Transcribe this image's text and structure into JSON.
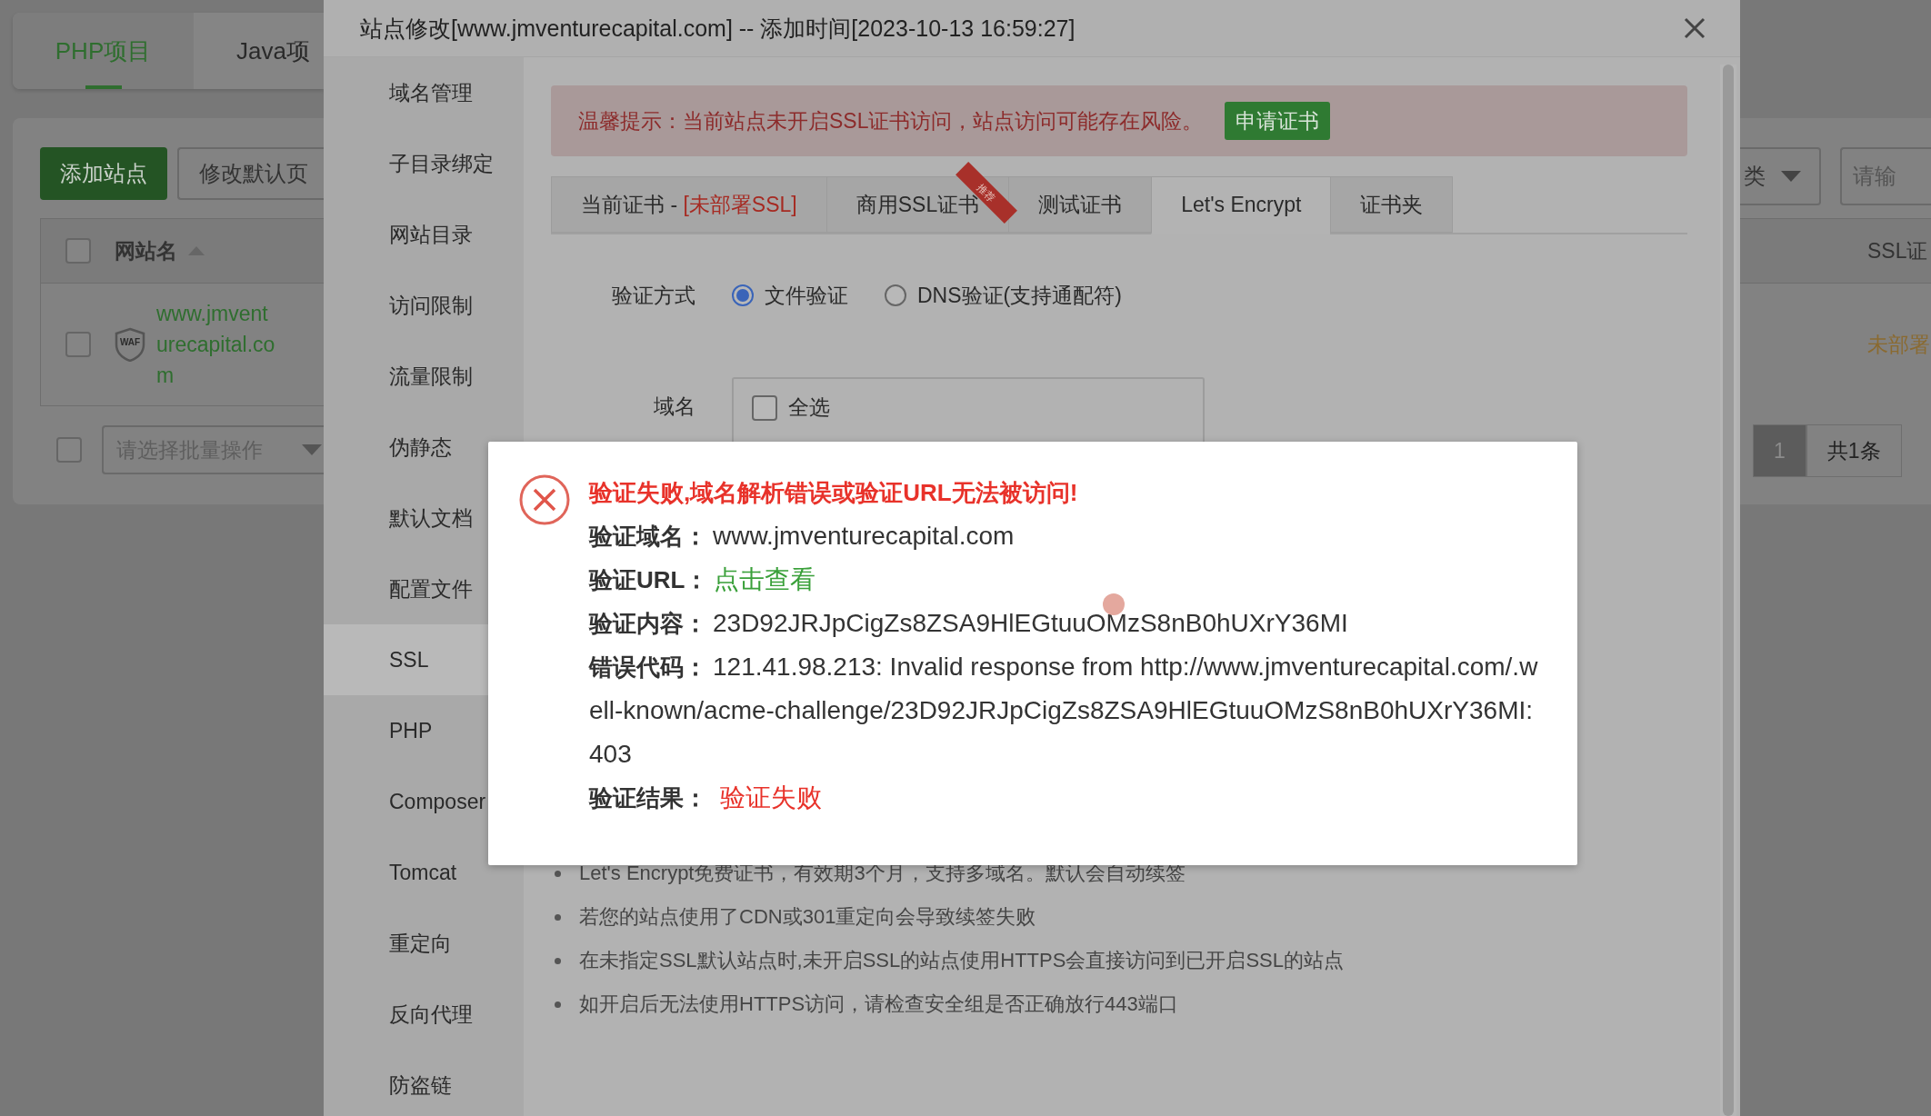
{
  "background_page": {
    "project_tabs": [
      {
        "label": "PHP项目",
        "selected": true
      },
      {
        "label": "Java项",
        "selected": false
      }
    ],
    "toolbar_buttons": [
      {
        "label": "添加站点",
        "kind": "primary"
      },
      {
        "label": "修改默认页",
        "kind": "default"
      }
    ],
    "category_select": {
      "value": "类"
    },
    "search_field": {
      "placeholder": "请输"
    },
    "table": {
      "header_checked": false,
      "columns": [
        "网站名",
        "SSL证"
      ],
      "rows": [
        {
          "checked": false,
          "badge": "WAF",
          "name": "www.jmventurecapital.com",
          "ssl": "未部署"
        }
      ]
    },
    "batch": {
      "checked": false,
      "placeholder": "请选择批量操作"
    },
    "pagination": {
      "pages": [
        {
          "label": "1",
          "selected": true
        }
      ],
      "total": "共1条"
    }
  },
  "modal": {
    "title": "站点修改[www.jmventurecapital.com] -- 添加时间[2023-10-13 16:59:27]",
    "sidebar": {
      "items": [
        {
          "label": "域名管理",
          "selected": false
        },
        {
          "label": "子目录绑定",
          "selected": false
        },
        {
          "label": "网站目录",
          "selected": false
        },
        {
          "label": "访问限制",
          "selected": false
        },
        {
          "label": "流量限制",
          "selected": false
        },
        {
          "label": "伪静态",
          "selected": false
        },
        {
          "label": "默认文档",
          "selected": false
        },
        {
          "label": "配置文件",
          "selected": false
        },
        {
          "label": "SSL",
          "selected": true
        },
        {
          "label": "PHP",
          "selected": false
        },
        {
          "label": "Composer",
          "selected": false
        },
        {
          "label": "Tomcat",
          "selected": false
        },
        {
          "label": "重定向",
          "selected": false
        },
        {
          "label": "反向代理",
          "selected": false
        },
        {
          "label": "防盗链",
          "selected": false
        }
      ]
    },
    "alert": {
      "text": "温馨提示：当前站点未开启SSL证书访问，站点访问可能存在风险。",
      "button": "申请证书"
    },
    "cert_tabs": [
      {
        "label": "当前证书 - ",
        "status": "[未部署SSL]",
        "selected": false
      },
      {
        "label": "商用SSL证书",
        "badge": "推荐",
        "selected": false
      },
      {
        "label": "测试证书",
        "selected": false
      },
      {
        "label": "Let's Encrypt",
        "selected": true
      },
      {
        "label": "证书夹",
        "selected": false
      }
    ],
    "verify_method": {
      "label": "验证方式",
      "options": [
        {
          "label": "文件验证",
          "selected": true
        },
        {
          "label": "DNS验证(支持通配符)",
          "selected": false
        }
      ]
    },
    "domain": {
      "label": "域名",
      "select_all": {
        "label": "全选",
        "checked": false
      }
    },
    "notes": [
      "Let's Encrypt免费证书，有效期3个月，支持多域名。默认会自动续签",
      "若您的站点使用了CDN或301重定向会导致续签失败",
      "在未指定SSL默认站点时,未开启SSL的站点使用HTTPS会直接访问到已开启SSL的站点",
      "如开启后无法使用HTTPS访问，请检查安全组是否正确放行443端口"
    ]
  },
  "error_popup": {
    "title": "验证失败,域名解析错误或验证URL无法被访问!",
    "fields": [
      {
        "label": "验证域名：",
        "value": "www.jmventurecapital.com",
        "kind": "text"
      },
      {
        "label": "验证URL：",
        "value": "点击查看",
        "kind": "link"
      },
      {
        "label": "验证内容：",
        "value": "23D92JRJpCigZs8ZSA9HlEGtuuOMzS8nB0hUXrY36MI",
        "kind": "text"
      },
      {
        "label": "错误代码：",
        "value": "121.41.98.213: Invalid response from http://www.jmventurecapital.com/.well-known/acme-challenge/23D92JRJpCigZs8ZSA9HlEGtuuOMzS8nB0hUXrY36MI: 403",
        "kind": "wrapped"
      },
      {
        "label": "验证结果：",
        "value": "验证失败",
        "kind": "error"
      }
    ]
  }
}
